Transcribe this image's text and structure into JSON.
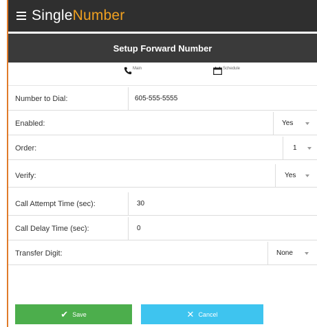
{
  "app": {
    "brand_primary": "Single",
    "brand_accent": "Number",
    "accent_color": "#f0a020",
    "header_color": "#2f2f2f"
  },
  "page": {
    "title": "Setup Forward Number"
  },
  "tabs": [
    {
      "label": "Main",
      "icon": "phone-icon"
    },
    {
      "label": "Schedule",
      "icon": "calendar-icon"
    }
  ],
  "form": {
    "number_to_dial": {
      "label": "Number to Dial:",
      "value": "605-555-5555"
    },
    "enabled": {
      "label": "Enabled:",
      "value": "Yes"
    },
    "order": {
      "label": "Order:",
      "value": "1"
    },
    "verify": {
      "label": "Verify:",
      "value": "Yes"
    },
    "call_attempt_time": {
      "label": "Call Attempt Time (sec):",
      "value": "30"
    },
    "call_delay_time": {
      "label": "Call Delay Time (sec):",
      "value": "0"
    },
    "transfer_digit": {
      "label": "Transfer Digit:",
      "value": "None"
    }
  },
  "footer": {
    "save_label": "Save",
    "cancel_label": "Cancel",
    "save_color": "#4cae4c",
    "cancel_color": "#3ec4ef"
  }
}
